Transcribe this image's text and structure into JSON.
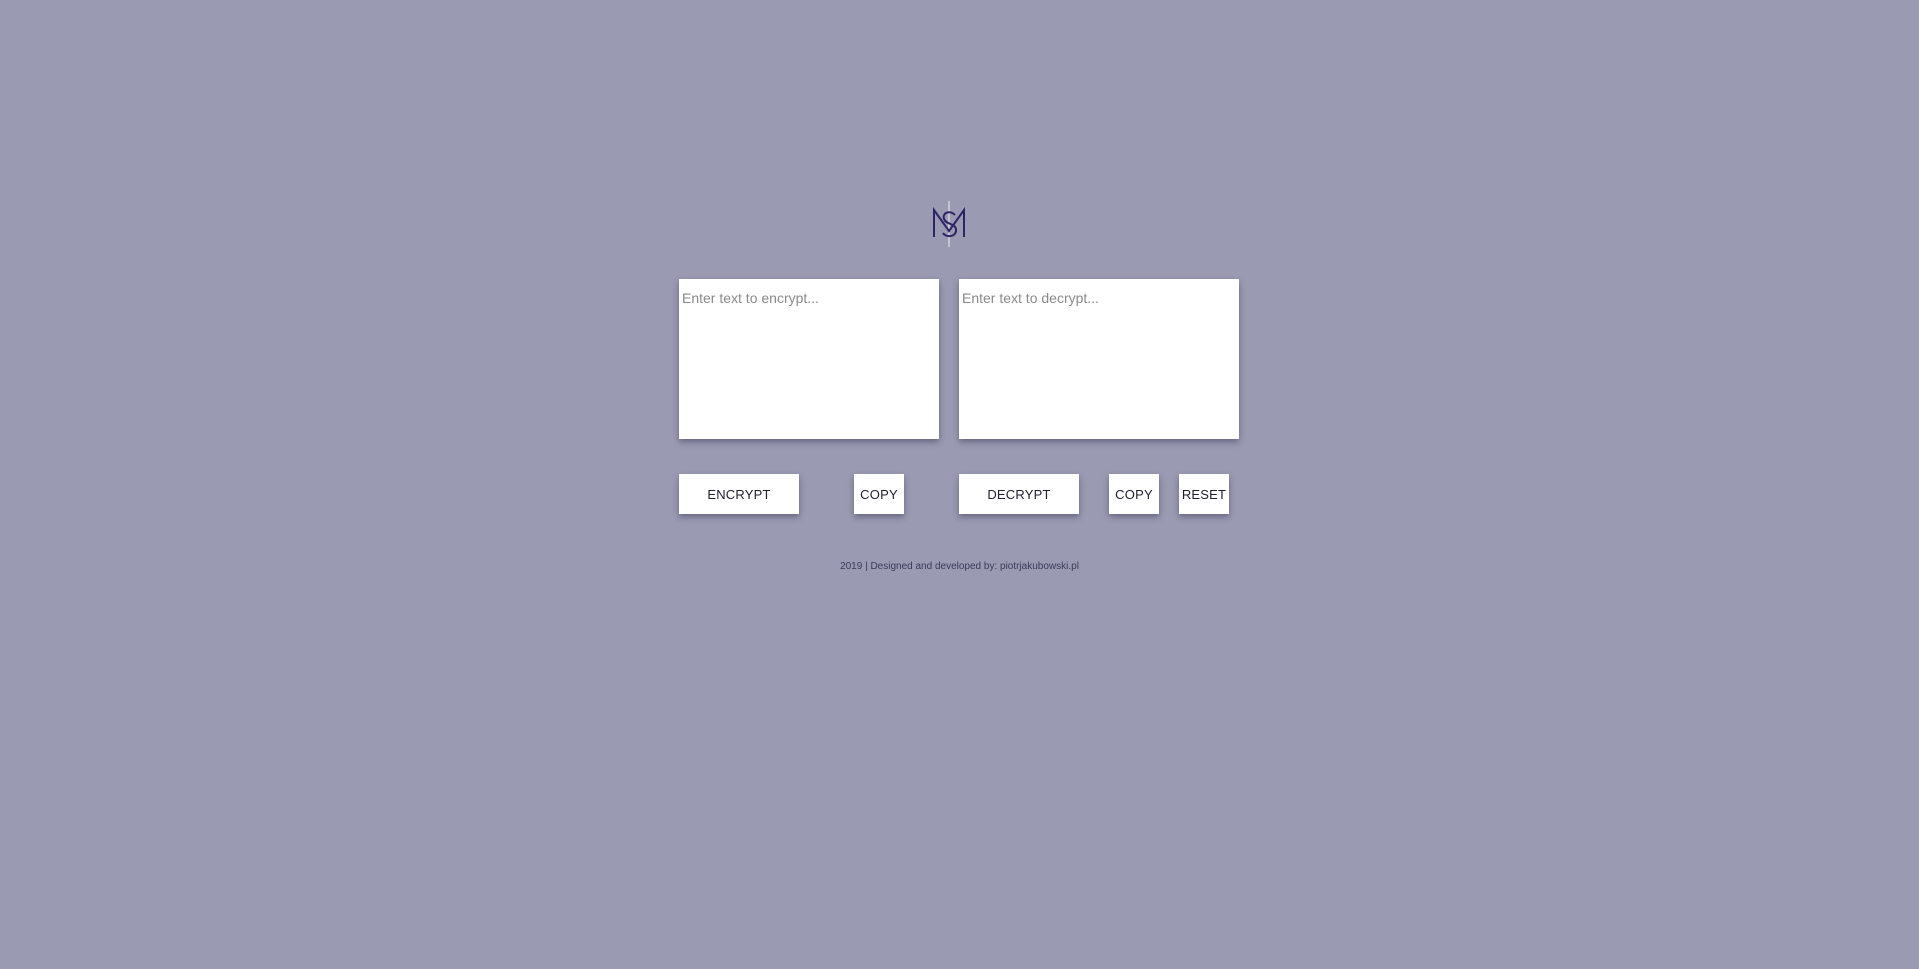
{
  "logo": {
    "icon": "ms-monogram-logo",
    "color": "#2c2466"
  },
  "encrypt": {
    "placeholder": "Enter text to encrypt...",
    "value": ""
  },
  "decrypt": {
    "placeholder": "Enter text to decrypt...",
    "value": ""
  },
  "buttons": {
    "encrypt_label": "ENCRYPT",
    "copy_encrypted_label": "COPY",
    "decrypt_label": "DECRYPT",
    "copy_decrypted_label": "COPY",
    "reset_label": "RESET"
  },
  "footer": {
    "text": "2019 | Designed and developed by: piotrjakubowski.pl"
  },
  "colors": {
    "background": "#9a9ab2",
    "panel": "#ffffff",
    "text": "#1e1e2e"
  }
}
